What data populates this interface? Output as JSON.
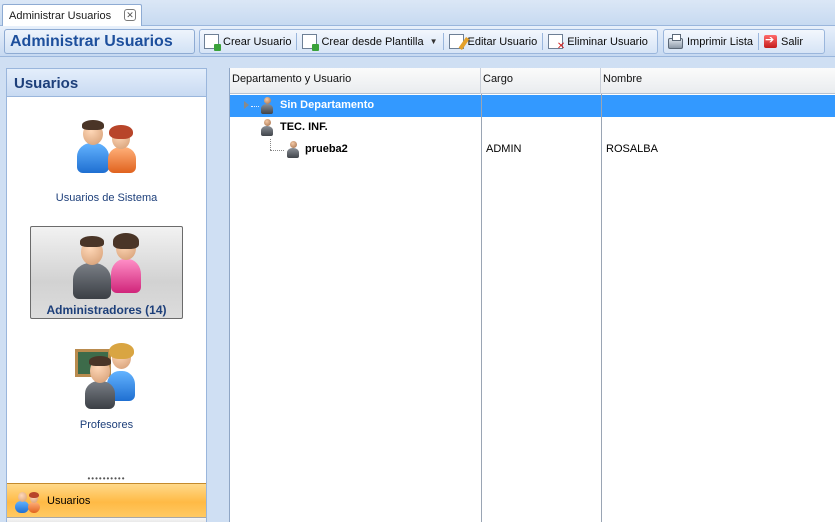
{
  "tab": {
    "title": "Administrar Usuarios",
    "close_icon": "close-icon"
  },
  "toolbar": {
    "title": "Administrar Usuarios",
    "buttons": [
      {
        "label": "Crear Usuario",
        "icon": "new-document-icon"
      },
      {
        "label": "Crear desde Plantilla",
        "icon": "template-document-icon"
      },
      {
        "label": "Editar Usuario",
        "icon": "edit-icon"
      },
      {
        "label": "Eliminar Usuario",
        "icon": "delete-icon"
      },
      {
        "label": "Imprimir Lista",
        "icon": "printer-icon"
      },
      {
        "label": "Salir",
        "icon": "exit-icon"
      }
    ]
  },
  "sidebar": {
    "header": "Usuarios",
    "items": [
      {
        "label": "Usuarios de Sistema",
        "icon": "users-icon",
        "selected": false
      },
      {
        "label": "Administradores (14)",
        "icon": "administrators-icon",
        "selected": true
      },
      {
        "label": "Profesores",
        "icon": "teachers-icon",
        "selected": false
      }
    ],
    "grip": "••••••••••",
    "nav": {
      "label": "Usuarios",
      "icon": "users-icon"
    }
  },
  "grid": {
    "columns": [
      "Departamento y Usuario",
      "Cargo",
      "Nombre"
    ],
    "rows": [
      {
        "name": "Sin Departamento",
        "cargo": "",
        "nombre": "",
        "level": 0,
        "selected": true,
        "expandable": true
      },
      {
        "name": "TEC. INF.",
        "cargo": "",
        "nombre": "",
        "level": 0,
        "selected": false,
        "expandable": false
      },
      {
        "name": "prueba2",
        "cargo": "ADMIN",
        "nombre": "ROSALBA",
        "level": 1,
        "selected": false,
        "expandable": false
      }
    ]
  },
  "colors": {
    "accent": "#1d4f9c",
    "selection": "#3399ff",
    "nav_active": "#ffba45"
  }
}
